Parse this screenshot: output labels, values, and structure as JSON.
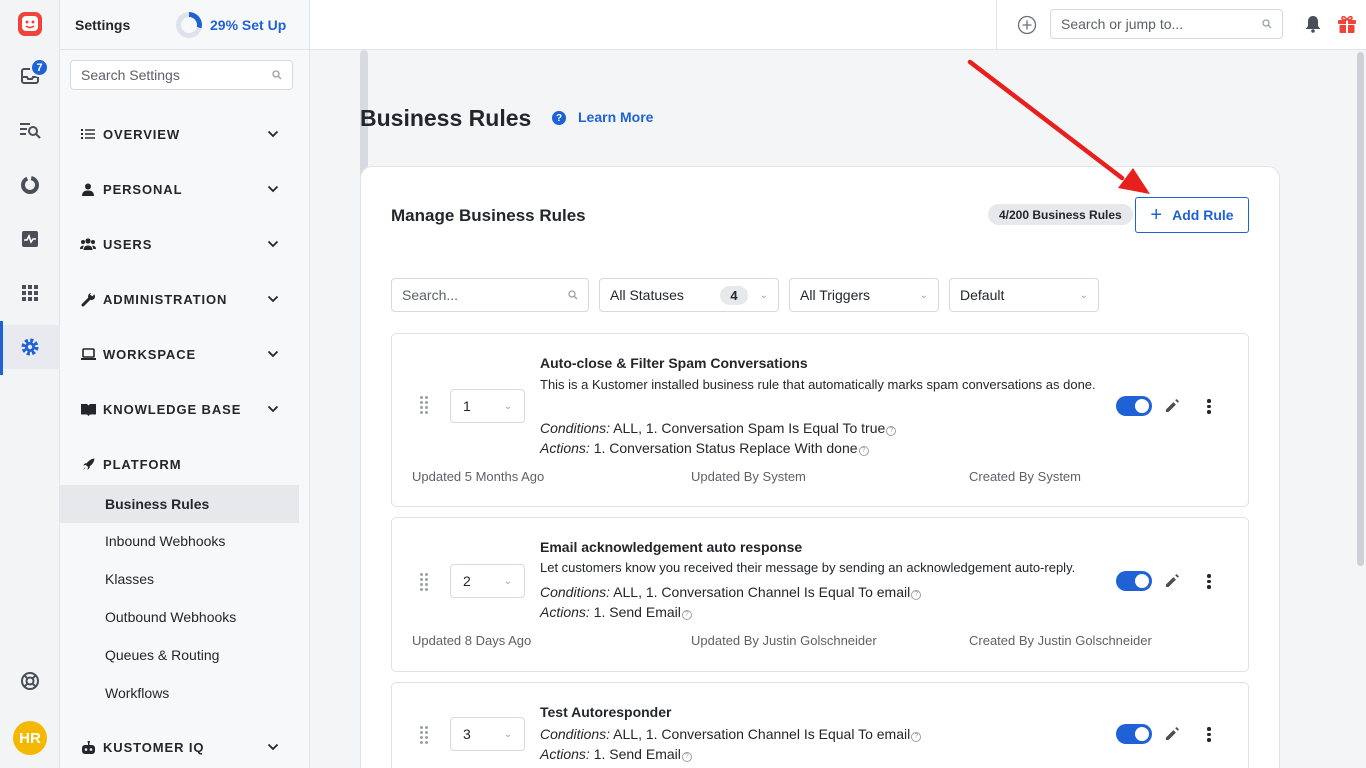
{
  "rail": {
    "inbox_badge": "7",
    "avatar_initials": "HR",
    "colors": {
      "brand": "#f0443a",
      "accent": "#1f62d6",
      "avatar": "#f5b800"
    }
  },
  "settings_nav": {
    "title": "Settings",
    "setup_progress_label": "29% Set Up",
    "setup_progress_value": 0.29,
    "search_placeholder": "Search Settings",
    "sections": [
      {
        "label": "OVERVIEW",
        "icon": "list-icon"
      },
      {
        "label": "PERSONAL",
        "icon": "person-icon"
      },
      {
        "label": "USERS",
        "icon": "users-icon"
      },
      {
        "label": "ADMINISTRATION",
        "icon": "wrench-icon"
      },
      {
        "label": "WORKSPACE",
        "icon": "laptop-icon"
      },
      {
        "label": "KNOWLEDGE BASE",
        "icon": "book-icon"
      },
      {
        "label": "PLATFORM",
        "icon": "rocket-icon"
      }
    ],
    "platform_items": [
      "Business Rules",
      "Inbound Webhooks",
      "Klasses",
      "Outbound Webhooks",
      "Queues & Routing",
      "Workflows"
    ],
    "last_section": {
      "label": "KUSTOMER IQ",
      "icon": "robot-icon"
    }
  },
  "topbar": {
    "search_placeholder": "Search or jump to..."
  },
  "page": {
    "title": "Business Rules",
    "learn_more": "Learn More"
  },
  "card": {
    "title": "Manage Business Rules",
    "count": "4/200 Business Rules",
    "add_rule": "Add Rule",
    "filters": {
      "search_placeholder": "Search...",
      "statuses": "All Statuses",
      "statuses_count": "4",
      "triggers": "All Triggers",
      "sort": "Default"
    }
  },
  "rules": [
    {
      "order": "1",
      "name": "Auto-close & Filter Spam Conversations",
      "description": "This is a Kustomer installed business rule that automatically marks spam conversations as done.",
      "conditions_label": "Conditions:",
      "conditions": "ALL, 1. Conversation Spam Is Equal To true",
      "actions_label": "Actions:",
      "actions": "1. Conversation Status Replace With done",
      "updated": "Updated 5 Months Ago",
      "updated_by": "Updated By System",
      "created_by": "Created By System",
      "enabled": true
    },
    {
      "order": "2",
      "name": "Email acknowledgement auto response",
      "description": "Let customers know you received their message by sending an acknowledgement auto-reply.",
      "conditions_label": "Conditions:",
      "conditions": "ALL, 1. Conversation Channel Is Equal To email",
      "actions_label": "Actions:",
      "actions": "1. Send Email",
      "updated": "Updated 8 Days Ago",
      "updated_by": "Updated By Justin Golschneider",
      "created_by": "Created By Justin Golschneider",
      "enabled": true
    },
    {
      "order": "3",
      "name": "Test Autoresponder",
      "conditions_label": "Conditions:",
      "conditions": "ALL, 1. Conversation Channel Is Equal To email",
      "actions_label": "Actions:",
      "actions": "1. Send Email",
      "enabled": true
    }
  ],
  "annotation": {
    "arrow_color": "#e8201d",
    "points_to": "add-rule-button"
  }
}
